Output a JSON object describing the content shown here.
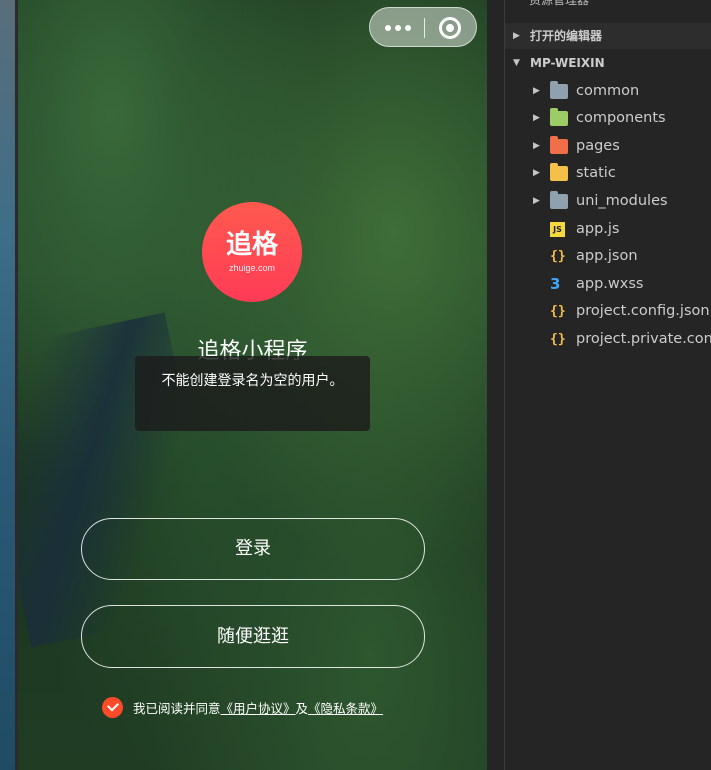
{
  "phone": {
    "logo_cn": "追格",
    "logo_en": "zhuige.com",
    "app_title": "追格小程序",
    "toast_message": "不能创建登录名为空的用户。",
    "login_label": "登录",
    "browse_label": "随便逛逛",
    "agreement_prefix": "我已阅读并同意",
    "agreement_user_link": "《用户协议》",
    "agreement_and": "及",
    "agreement_privacy_link": "《隐私条款》",
    "accent_color": "#ff4a2a"
  },
  "explorer": {
    "title": "资源管理器",
    "open_editors_label": "打开的编辑器",
    "project_label": "MP-WEIXIN",
    "items": [
      {
        "label": "common",
        "kind": "folder",
        "icon": "folder-icon"
      },
      {
        "label": "components",
        "kind": "folder",
        "icon": "components-folder-icon"
      },
      {
        "label": "pages",
        "kind": "folder",
        "icon": "pages-folder-icon"
      },
      {
        "label": "static",
        "kind": "folder",
        "icon": "static-folder-icon"
      },
      {
        "label": "uni_modules",
        "kind": "folder",
        "icon": "folder-icon"
      },
      {
        "label": "app.js",
        "kind": "file",
        "icon": "js-file-icon"
      },
      {
        "label": "app.json",
        "kind": "file",
        "icon": "json-file-icon"
      },
      {
        "label": "app.wxss",
        "kind": "file",
        "icon": "css-file-icon"
      },
      {
        "label": "project.config.json",
        "kind": "file",
        "icon": "json-file-icon"
      },
      {
        "label": "project.private.config.json",
        "kind": "file",
        "icon": "json-file-icon"
      }
    ]
  }
}
